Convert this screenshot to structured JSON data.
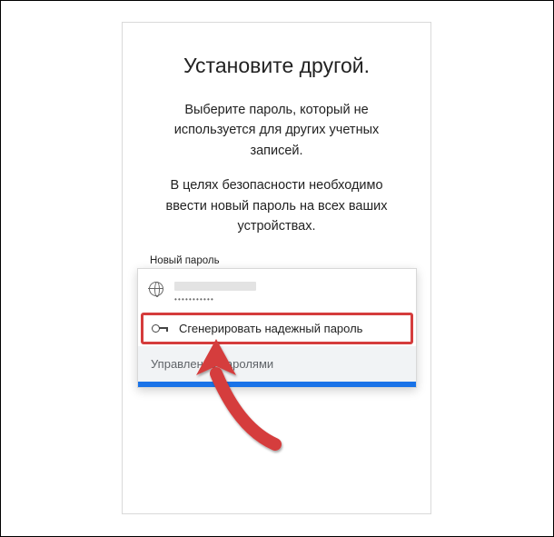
{
  "title": "Установите другой.",
  "subtitle1": "Выберите пароль, который не используется для других учетных записей.",
  "subtitle2": "В целях безопасности необходимо ввести новый пароль на всех ваших устройствах.",
  "label_new_password": "Новый пароль",
  "dropdown": {
    "masked_password": "•••••••••••",
    "generate_label": "Сгенерировать надежный пароль",
    "manage_label": "Управление паролями"
  }
}
